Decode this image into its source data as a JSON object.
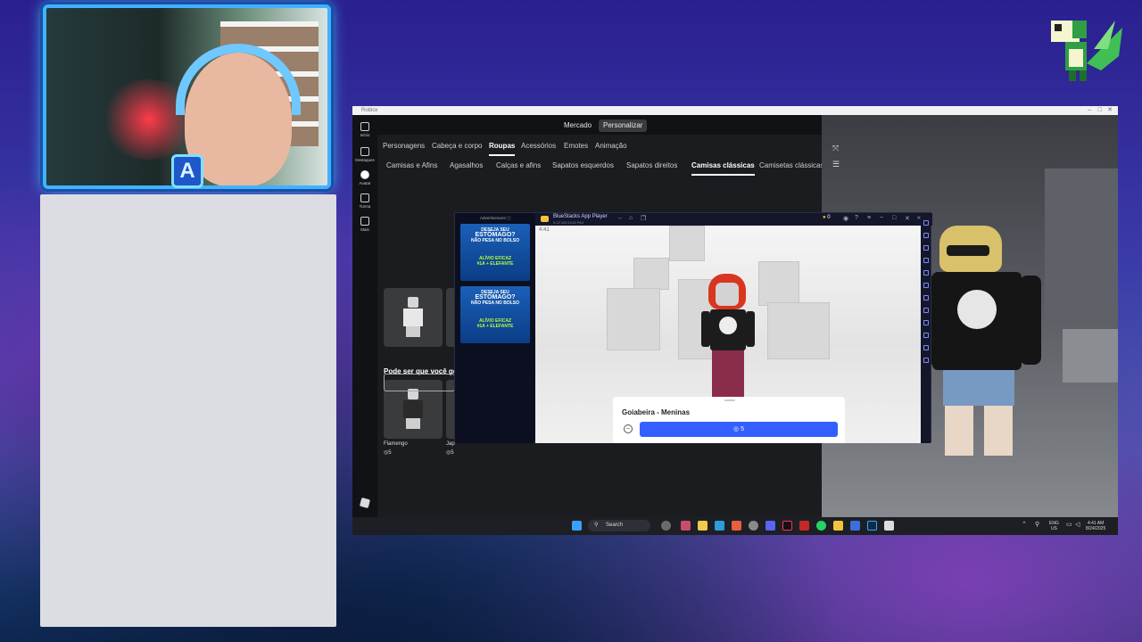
{
  "roblox": {
    "window_title": "Roblox",
    "nav": {
      "market": "Mercado",
      "customize": "Personalizar"
    },
    "robux_balance": "32",
    "rail": [
      "Início",
      "Destaques",
      "Avatar",
      "Turma",
      "Mais"
    ],
    "categories": [
      "Personagens",
      "Cabeça e corpo",
      "Roupas",
      "Acessórios",
      "Emotes",
      "Animação"
    ],
    "active_category": "Roupas",
    "subcategories": [
      "Camisas e Afins",
      "Agasalhos",
      "Calças e afins",
      "Sapatos esquerdos",
      "Sapatos direitos",
      "Camisas clássicas",
      "Camisetas clássicas"
    ],
    "active_subcategory": "Camisas clássicas",
    "suggestion_title": "Pode ser que você gos",
    "suggestions": [
      {
        "name": "Flamengo",
        "price": "5"
      },
      {
        "name": "Jap",
        "price": "5"
      }
    ]
  },
  "bluestacks": {
    "title": "BlueStacks App Player",
    "subtitle": "5.22.100.1016 P64",
    "coins": "0",
    "status_time": "4:41",
    "ads_header": "Advertisement ⓘ",
    "ad_lines": [
      "DESEJA SEU",
      "ESTÔMAGO?",
      "NÃO PESA NO BOLSO",
      "ALÍVIO EFICAZ",
      "#1A + ELEFANTE"
    ],
    "item_name": "Goiabeira - Meninas",
    "buy_price": "5"
  },
  "taskbar": {
    "search_label": "Search",
    "lang_top": "ENG",
    "lang_bottom": "US",
    "time": "4:41 AM",
    "date": "8/24/2025"
  },
  "overlay": {
    "badge_letter": "A"
  },
  "colors": {
    "accent_blue": "#335fff",
    "frame_cyan": "#3fb3ff",
    "roblox_bg": "#111216"
  }
}
